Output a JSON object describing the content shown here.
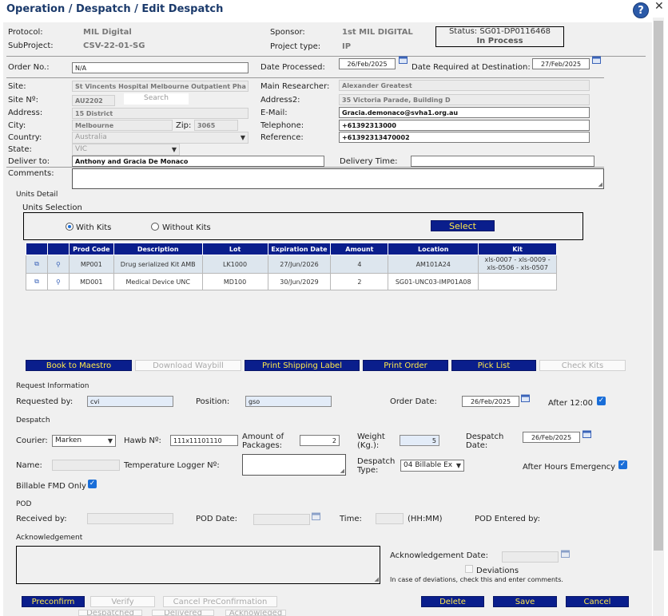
{
  "header": {
    "title": "Operation / Despatch / Edit Despatch",
    "help": "?",
    "close": "✕"
  },
  "labels": {
    "protocol": "Protocol:",
    "subproject": "SubProject:",
    "sponsor": "Sponsor:",
    "project_type": "Project type:",
    "order_no": "Order No.:",
    "date_processed": "Date Processed:",
    "date_required": "Date Required at Destination:",
    "site": "Site:",
    "site_no": "Site Nº:",
    "address": "Address:",
    "city": "City:",
    "zip": "Zip:",
    "country": "Country:",
    "state": "State:",
    "deliver_to": "Deliver to:",
    "comments": "Comments:",
    "main_researcher": "Main Researcher:",
    "address2": "Address2:",
    "email": "E-Mail:",
    "telephone": "Telephone:",
    "reference": "Reference:",
    "delivery_time": "Delivery Time:",
    "units_detail": "Units Detail",
    "units_selection": "Units Selection",
    "with_kits": "With Kits",
    "without_kits": "Without Kits",
    "request_info": "Request Information",
    "requested_by": "Requested by:",
    "position": "Position:",
    "order_date": "Order Date:",
    "after_12": "After 12:00",
    "despatch": "Despatch",
    "courier": "Courier:",
    "hawb": "Hawb Nº:",
    "amount_packages": "Amount of Packages:",
    "weight": "Weight (Kg.):",
    "despatch_date": "Despatch Date:",
    "name": "Name:",
    "temp_logger": "Temperature Logger Nº:",
    "despatch_type": "Despatch Type:",
    "after_hours": "After Hours Emergency",
    "billable_fmd": "Billable FMD Only",
    "pod": "POD",
    "received_by": "Received by:",
    "pod_date": "POD Date:",
    "time": "Time:",
    "hhmm": "(HH:MM)",
    "pod_entered_by": "POD Entered by:",
    "acknowledgement": "Acknowledgement",
    "ack_date": "Acknowledgement Date:",
    "deviations": "Deviations",
    "deviations_note": "In case of deviations, check this and enter comments."
  },
  "values": {
    "protocol": "MIL Digital",
    "subproject": "CSV-22-01-SG",
    "sponsor": "1st MIL DIGITAL",
    "project_type": "IP",
    "status_line1": "Status: SG01-DP0116468",
    "status_line2": "In Process",
    "order_no": "N/A",
    "date_processed": "26/Feb/2025",
    "date_required": "27/Feb/2025",
    "site": "St Vincents Hospital Melbourne Outpatient Pha",
    "site_no": "AU2202",
    "search": "Search",
    "address": "15 District",
    "city": "Melbourne",
    "zip": "3065",
    "country": "Australia",
    "state": "VIC",
    "deliver_to": "Anthony and Gracia De Monaco",
    "main_researcher": "Alexander Greatest",
    "address2": "35 Victoria Parade, Building D",
    "email": "Gracia.demonaco@svha1.org.au",
    "telephone": "+61392313000",
    "reference": "+61392313470002",
    "requested_by": "cvi",
    "position": "gso",
    "order_date": "26/Feb/2025",
    "courier": "Marken",
    "hawb": "111x11101110",
    "amount_packages": "2",
    "weight": "5",
    "despatch_date": "26/Feb/2025",
    "despatch_type": "04 Billable Ex"
  },
  "buttons": {
    "select": "Select",
    "book_maestro": "Book to Maestro",
    "download_waybill": "Download Waybill",
    "print_shipping": "Print Shipping Label",
    "print_order": "Print Order",
    "pick_list": "Pick List",
    "check_kits": "Check Kits",
    "preconfirm": "Preconfirm",
    "verify": "Verify",
    "cancel_preconf": "Cancel PreConfirmation",
    "delete": "Delete",
    "save": "Save",
    "cancel": "Cancel",
    "despatched": "Despatched",
    "delivered": "Delivered",
    "acknowledged": "Acknowleged"
  },
  "table": {
    "headers": [
      "Prod Code",
      "Description",
      "Lot",
      "Expiration Date",
      "Amount",
      "Location",
      "Kit"
    ],
    "rows": [
      [
        "MP001",
        "Drug serialized Kit AMB",
        "LK1000",
        "27/Jun/2026",
        "4",
        "AM101A24",
        "xls-0007 - xls-0009 - xls-0506 - xls-0507"
      ],
      [
        "MD001",
        "Medical Device UNC",
        "MD100",
        "30/Jun/2029",
        "2",
        "SG01-UNC03-IMP01A08",
        ""
      ]
    ]
  },
  "colors": {
    "accent_button": "#0a1e8c",
    "button_text": "#ffe94a",
    "link_blue": "#1b3a6b"
  }
}
